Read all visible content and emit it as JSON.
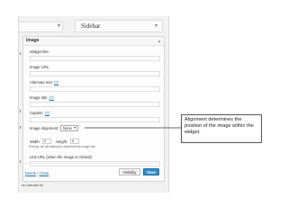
{
  "sidebar": {
    "title": "Sidebar"
  },
  "widget": {
    "title": "Image",
    "fields": {
      "widget_title": "Widget title:",
      "image_url": "Image URL:",
      "alternate_text_label": "Alternate text:",
      "alternate_text_help": "(?)",
      "image_title_label": "Image title:",
      "image_title_help": "(?)",
      "caption_label": "Caption:",
      "caption_help": "(?)",
      "image_alignment_label": "Image Alignment:",
      "image_alignment_value": "None",
      "width_label": "Width:",
      "width_value": "0",
      "height_label": "Height:",
      "height_value": "0",
      "size_hint": "If empty, we will attempt to determine the image size.",
      "link_url_label": "Link URL (when the image is clicked):"
    },
    "footer": {
      "delete": "Delete",
      "separator": "|",
      "close": "Close",
      "visibility_button": "Visibility",
      "save_button": "Save"
    }
  },
  "bottom_note": "ne calendar for",
  "callout": {
    "text": "Alignment determines the position of the image within the widget."
  }
}
